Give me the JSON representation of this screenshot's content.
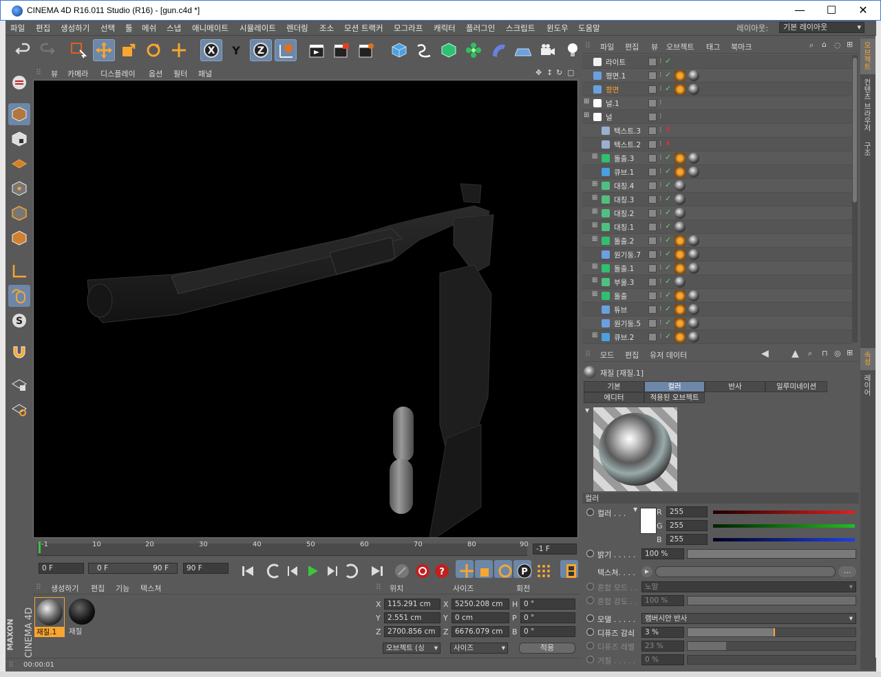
{
  "window": {
    "title": "CINEMA 4D R16.011 Studio (R16) - [gun.c4d *]",
    "minimize": "—",
    "maximize": "☐",
    "close": "✕"
  },
  "menu": {
    "items": [
      "파일",
      "편집",
      "생성하기",
      "선택",
      "툴",
      "메쉬",
      "스냅",
      "애니메이트",
      "시뮬레이트",
      "렌더링",
      "조소",
      "모션 트랙커",
      "모그라프",
      "캐릭터",
      "플러그인",
      "스크립트",
      "윈도우",
      "도움말"
    ],
    "layout_label": "레이아웃:",
    "layout_value": "기본 레이아웃"
  },
  "viewport_menu": {
    "items": [
      "뷰",
      "카메라",
      "디스플레이",
      "옵션",
      "필터",
      "패널"
    ]
  },
  "timeline": {
    "ticks": [
      "-1",
      "10",
      "20",
      "30",
      "40",
      "50",
      "60",
      "70",
      "80",
      "90"
    ],
    "current_frame": "-1 F"
  },
  "anim": {
    "start": "0 F",
    "range_start": "0 F",
    "range_end": "90 F",
    "end": "90 F"
  },
  "material_manager": {
    "menu": [
      "생성하기",
      "편집",
      "기능",
      "텍스쳐"
    ],
    "materials": [
      {
        "name": "재질.1",
        "selected": true
      },
      {
        "name": "재질",
        "selected": false
      }
    ]
  },
  "coords": {
    "headers": [
      "위치",
      "사이즈",
      "회전"
    ],
    "rows": [
      {
        "axis": "X",
        "pos": "115.291 cm",
        "saxis": "X",
        "size": "5250.208 cm",
        "raxis": "H",
        "rot": "0 °"
      },
      {
        "axis": "Y",
        "pos": "2.551 cm",
        "saxis": "Y",
        "size": "0 cm",
        "raxis": "P",
        "rot": "0 °"
      },
      {
        "axis": "Z",
        "pos": "2700.856 cm",
        "saxis": "Z",
        "size": "6676.079 cm",
        "raxis": "B",
        "rot": "0 °"
      }
    ],
    "mode_select": "오브젝트 (싱",
    "size_select": "사이즈",
    "apply": "적용"
  },
  "status": {
    "time": "00:00:01"
  },
  "object_manager": {
    "menu": [
      "파일",
      "편집",
      "뷰",
      "오브젝트",
      "태그",
      "북마크"
    ],
    "objects": [
      {
        "name": "라이트",
        "indent": 0,
        "expand": false,
        "icon": "light-icon",
        "tags": 0,
        "selected": false,
        "check": "✓"
      },
      {
        "name": "평면.1",
        "indent": 0,
        "expand": false,
        "icon": "plane-icon",
        "tags": 2,
        "selected": false,
        "check": "✓"
      },
      {
        "name": "평면",
        "indent": 0,
        "expand": false,
        "icon": "plane-icon",
        "tags": 2,
        "selected": true,
        "check": "✓"
      },
      {
        "name": "널.1",
        "indent": 0,
        "expand": true,
        "icon": "null-icon",
        "tags": 0,
        "selected": false,
        "check": ""
      },
      {
        "name": "널",
        "indent": 0,
        "expand": true,
        "icon": "null-icon",
        "tags": 0,
        "selected": false,
        "check": ""
      },
      {
        "name": "텍스트.3",
        "indent": 1,
        "expand": false,
        "icon": "text-icon",
        "tags": 0,
        "selected": false,
        "check": "✗"
      },
      {
        "name": "텍스트.2",
        "indent": 1,
        "expand": false,
        "icon": "text-icon",
        "tags": 0,
        "selected": false,
        "check": "✗"
      },
      {
        "name": "돌출.3",
        "indent": 1,
        "expand": true,
        "icon": "extrude-icon",
        "tags": 2,
        "selected": false,
        "check": "✓"
      },
      {
        "name": "큐브.1",
        "indent": 1,
        "expand": false,
        "icon": "cube-icon",
        "tags": 2,
        "selected": false,
        "check": "✓"
      },
      {
        "name": "대칭.4",
        "indent": 1,
        "expand": true,
        "icon": "symmetry-icon",
        "tags": 1,
        "selected": false,
        "check": "✓"
      },
      {
        "name": "대칭.3",
        "indent": 1,
        "expand": true,
        "icon": "symmetry-icon",
        "tags": 1,
        "selected": false,
        "check": "✓"
      },
      {
        "name": "대칭.2",
        "indent": 1,
        "expand": true,
        "icon": "symmetry-icon",
        "tags": 1,
        "selected": false,
        "check": "✓"
      },
      {
        "name": "대칭.1",
        "indent": 1,
        "expand": true,
        "icon": "symmetry-icon",
        "tags": 1,
        "selected": false,
        "check": "✓"
      },
      {
        "name": "돌출.2",
        "indent": 1,
        "expand": true,
        "icon": "extrude-icon",
        "tags": 2,
        "selected": false,
        "check": "✓"
      },
      {
        "name": "원기둥.7",
        "indent": 1,
        "expand": false,
        "icon": "cylinder-icon",
        "tags": 2,
        "selected": false,
        "check": "✓"
      },
      {
        "name": "돌출.1",
        "indent": 1,
        "expand": true,
        "icon": "extrude-icon",
        "tags": 2,
        "selected": false,
        "check": "✓"
      },
      {
        "name": "부울.3",
        "indent": 1,
        "expand": true,
        "icon": "boole-icon",
        "tags": 1,
        "selected": false,
        "check": "✓"
      },
      {
        "name": "돌출",
        "indent": 1,
        "expand": true,
        "icon": "extrude-icon",
        "tags": 2,
        "selected": false,
        "check": "✓"
      },
      {
        "name": "튜브",
        "indent": 1,
        "expand": false,
        "icon": "tube-icon",
        "tags": 2,
        "selected": false,
        "check": "✓"
      },
      {
        "name": "원기둥.5",
        "indent": 1,
        "expand": false,
        "icon": "cylinder-icon",
        "tags": 2,
        "selected": false,
        "check": "✓"
      },
      {
        "name": "큐브.2",
        "indent": 1,
        "expand": true,
        "icon": "cube-icon",
        "tags": 2,
        "selected": false,
        "check": "✓"
      }
    ]
  },
  "attributes": {
    "menu": [
      "모드",
      "편집",
      "유저 데이터"
    ],
    "title": "재질 [재질.1]",
    "tabs_row1": [
      "기본",
      "컬러",
      "반사",
      "일루미네이션"
    ],
    "tabs_row2": [
      "에디터",
      "적용된 오브젝트"
    ],
    "active_tab": "컬러",
    "section": "컬러",
    "color_label": "컬러 . . .",
    "rgb": [
      {
        "ch": "R",
        "val": "255",
        "color": "#e02020"
      },
      {
        "ch": "G",
        "val": "255",
        "color": "#20c020"
      },
      {
        "ch": "B",
        "val": "255",
        "color": "#2040e0"
      }
    ],
    "brightness_label": "밝기 . . . . .",
    "brightness": "100 %",
    "texture_label": "텍스쳐. . . .",
    "texture_btn": "...",
    "blend_mode_label": "혼합 모드 . .",
    "blend_mode": "노말",
    "blend_strength_label": "혼합 강도 . .",
    "blend_strength": "100 %",
    "model_label": "모델 . . . . .",
    "model": "램버시안 반사",
    "diffuse_falloff_label": "디퓨즈 감쇠",
    "diffuse_falloff": "3 %",
    "diffuse_falloff_frac": 0.52,
    "diffuse_level_label": "디퓨즈 레벨",
    "diffuse_level": "23 %",
    "roughness_label": "거칠 . . . . .",
    "roughness": "0 %"
  },
  "right_tabs": [
    "오브젝트",
    "컨텐츠 브라우저",
    "구조"
  ],
  "right_tabs_lower": [
    "속성",
    "레이어"
  ],
  "brand": {
    "line1": "MAXON",
    "line2": "CINEMA 4D"
  },
  "colors": {
    "accent": "#f9a630",
    "highlight": "#6d87a8",
    "bg": "#595959",
    "check": "#6fd36f",
    "cross": "#e03030"
  }
}
